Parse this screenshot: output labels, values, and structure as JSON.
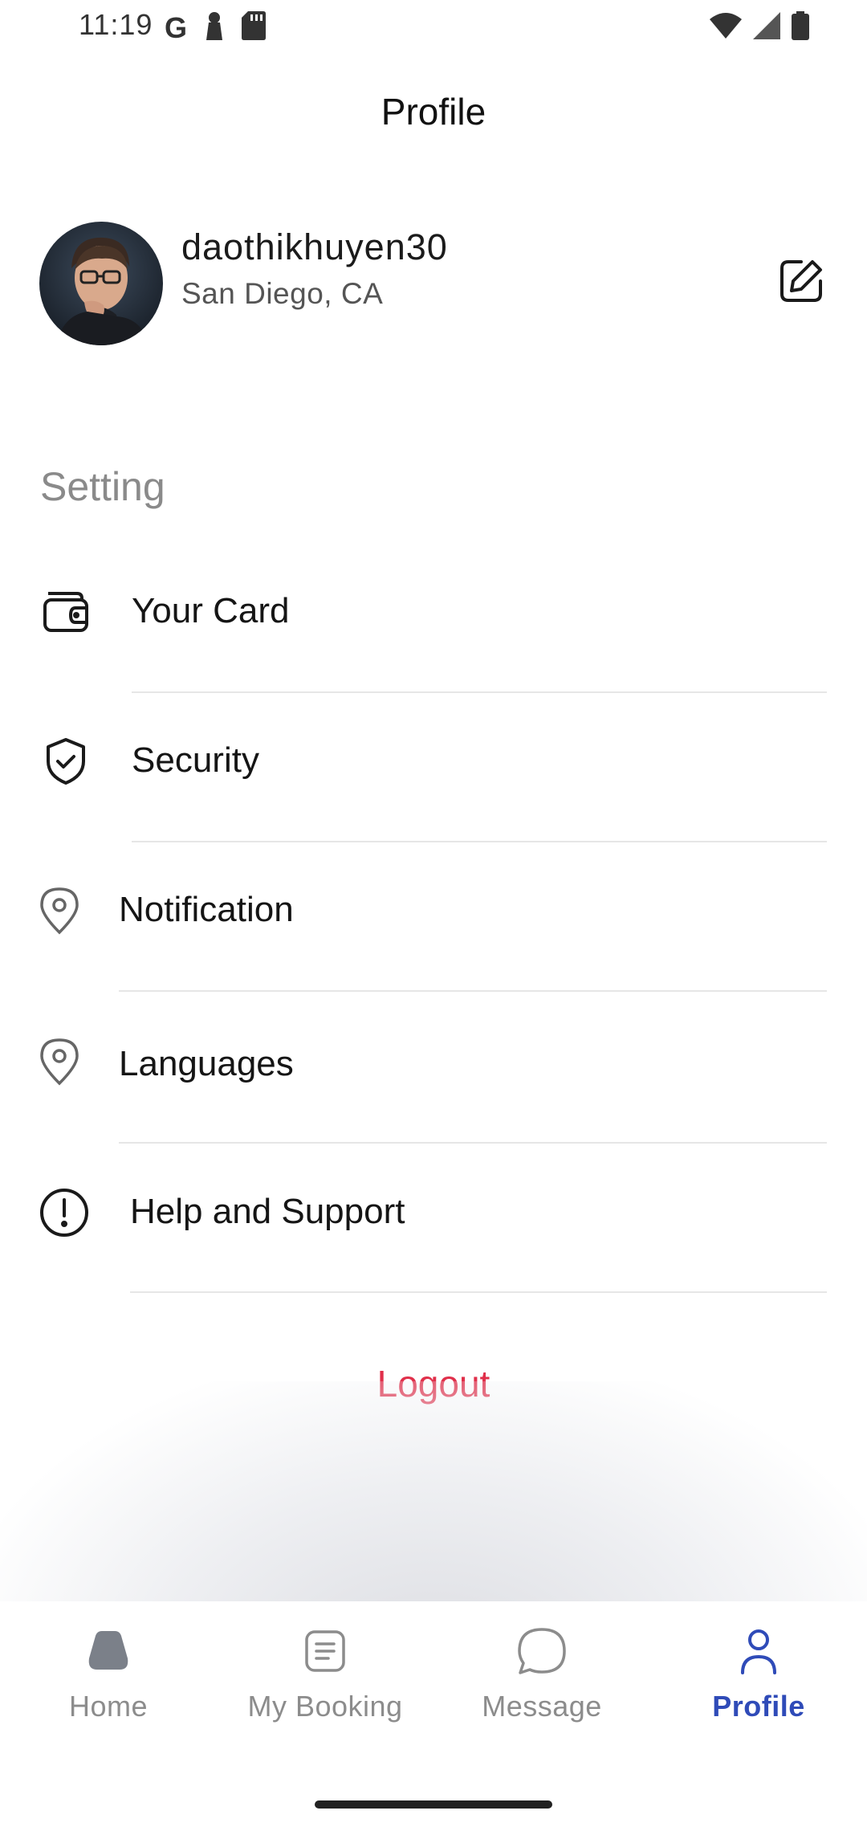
{
  "status_bar": {
    "time": "11:19",
    "google_glyph": "G",
    "icons": [
      "google-icon",
      "notification-icon",
      "sd-card-icon",
      "wifi-icon",
      "cellular-icon",
      "battery-icon"
    ]
  },
  "header": {
    "title": "Profile"
  },
  "profile": {
    "username": "daothikhuyen30",
    "location": "San Diego, CA",
    "avatar_icon": "avatar",
    "edit_icon": "edit-icon"
  },
  "settings": {
    "heading": "Setting",
    "items": [
      {
        "label": "Your Card",
        "icon": "wallet-icon"
      },
      {
        "label": "Security",
        "icon": "shield-icon"
      },
      {
        "label": "Notification",
        "icon": "location-pin-icon"
      },
      {
        "label": "Languages",
        "icon": "location-pin-icon"
      },
      {
        "label": "Help and Support",
        "icon": "alert-circle-icon"
      }
    ]
  },
  "logout_label": "Logout",
  "bottom_nav": {
    "active": "Profile",
    "items": [
      {
        "label": "Home",
        "icon": "home-icon"
      },
      {
        "label": "My Booking",
        "icon": "booking-icon"
      },
      {
        "label": "Message",
        "icon": "message-icon"
      },
      {
        "label": "Profile",
        "icon": "profile-icon"
      }
    ]
  },
  "colors": {
    "accent": "#2f4bb8",
    "logout": "#e02f4a",
    "muted_text": "#8a8a8a"
  }
}
